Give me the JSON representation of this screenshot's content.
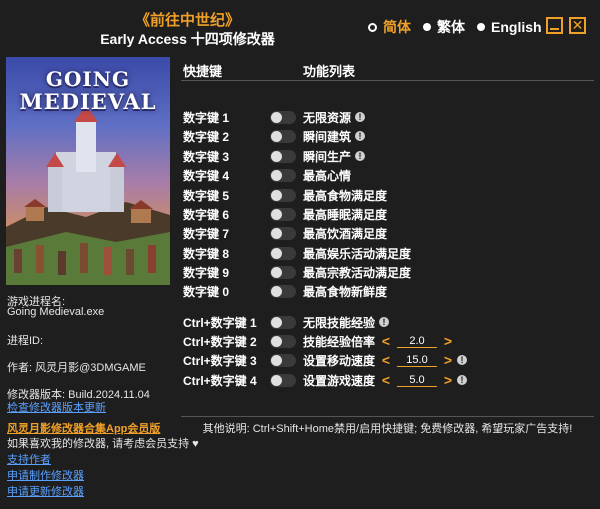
{
  "header": {
    "title": "《前往中世纪》",
    "subtitle": "Early Access 十四项修改器"
  },
  "languages": [
    {
      "label": "简体",
      "active": true
    },
    {
      "label": "繁体",
      "active": false
    },
    {
      "label": "English",
      "active": false
    }
  ],
  "window": {
    "minimize": "_",
    "close": "✕"
  },
  "cover": {
    "logo_line1": "GOING",
    "logo_line2": "MEDIEVAL"
  },
  "info": {
    "process_label": "游戏进程名:",
    "process_name": "Going Medieval.exe",
    "pid_label": "进程ID:",
    "author": "作者: 风灵月影@3DMGAME",
    "version": "修改器版本: Build.2024.11.04",
    "check_update": "检查修改器版本更新",
    "app_link": "风灵月影修改器合集App会员版",
    "support_text": "如果喜欢我的修改器, 请考虑会员支持 ♥",
    "support_author": "支持作者",
    "request_make": "申请制作修改器",
    "request_update": "申请更新修改器"
  },
  "columns": {
    "hotkey": "快捷键",
    "feature": "功能列表"
  },
  "cheats": [
    {
      "hotkey": "数字键 1",
      "name": "无限资源",
      "warn": "!"
    },
    {
      "hotkey": "数字键 2",
      "name": "瞬间建筑",
      "warn": "!"
    },
    {
      "hotkey": "数字键 3",
      "name": "瞬间生产",
      "warn": "!"
    },
    {
      "hotkey": "数字键 4",
      "name": "最高心情"
    },
    {
      "hotkey": "数字键 5",
      "name": "最高食物满足度"
    },
    {
      "hotkey": "数字键 6",
      "name": "最高睡眠满足度"
    },
    {
      "hotkey": "数字键 7",
      "name": "最高饮酒满足度"
    },
    {
      "hotkey": "数字键 8",
      "name": "最高娱乐活动满足度"
    },
    {
      "hotkey": "数字键 9",
      "name": "最高宗教活动满足度"
    },
    {
      "hotkey": "数字键 0",
      "name": "最高食物新鲜度"
    }
  ],
  "ctrl_cheats": [
    {
      "hotkey": "Ctrl+数字键 1",
      "name": "无限技能经验",
      "warn": "!"
    },
    {
      "hotkey": "Ctrl+数字键 2",
      "name": "技能经验倍率",
      "value": "2.0",
      "left": "<",
      "right": ">"
    },
    {
      "hotkey": "Ctrl+数字键 3",
      "name": "设置移动速度",
      "value": "15.0",
      "left": "<",
      "right": ">",
      "warn": "!"
    },
    {
      "hotkey": "Ctrl+数字键 4",
      "name": "设置游戏速度",
      "value": "5.0",
      "left": "<",
      "right": ">",
      "warn": "!"
    }
  ],
  "footer": "其他说明: Ctrl+Shift+Home禁用/启用快捷键; 免费修改器, 希望玩家广告支持!",
  "colors": {
    "accent": "#f0a028",
    "background": "#1e1e1e",
    "link": "#5aa0ff"
  }
}
